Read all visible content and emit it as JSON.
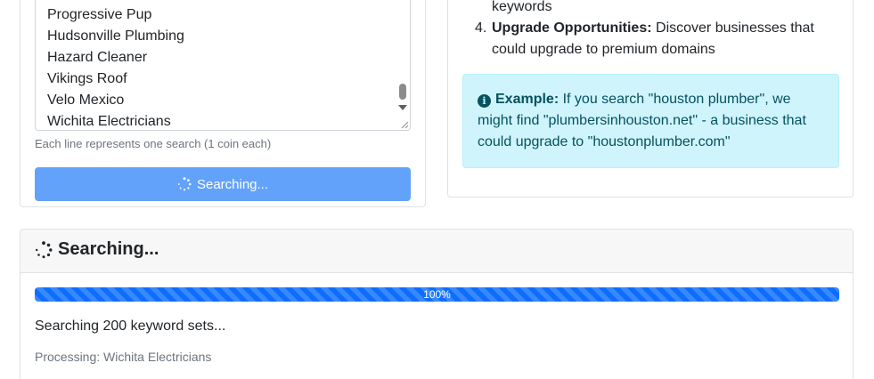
{
  "search_form": {
    "keyword_lines": [
      "Progressive Pup",
      "Hudsonville Plumbing",
      "Hazard Cleaner",
      "Vikings Roof",
      "Velo Mexico",
      "Wichita Electricians"
    ],
    "help_text": "Each line represents one search (1 coin each)",
    "search_button_label": "Searching..."
  },
  "info_panel": {
    "item3_continuation": "keywords",
    "item4_number": "4.",
    "item4_title": "Upgrade Opportunities:",
    "item4_text_line1": "Discover businesses that",
    "item4_text_line2": "could upgrade to premium domains",
    "example_label": "Example:",
    "example_line1": "If you search \"houston plumber\", we",
    "example_line2": "might find \"plumbersinhouston.net\" - a business that",
    "example_line3": "could upgrade to \"houstonplumber.com\""
  },
  "search_status": {
    "title": "Searching...",
    "progress_percent": 100,
    "progress_label": "100%",
    "status_text": "Searching 200 keyword sets...",
    "processing_text": "Processing: Wichita Electricians"
  },
  "colors": {
    "primary": "#0d6efd",
    "button_disabled": "#63a2fb",
    "alert_bg": "#cff4fc",
    "alert_text": "#055160"
  }
}
